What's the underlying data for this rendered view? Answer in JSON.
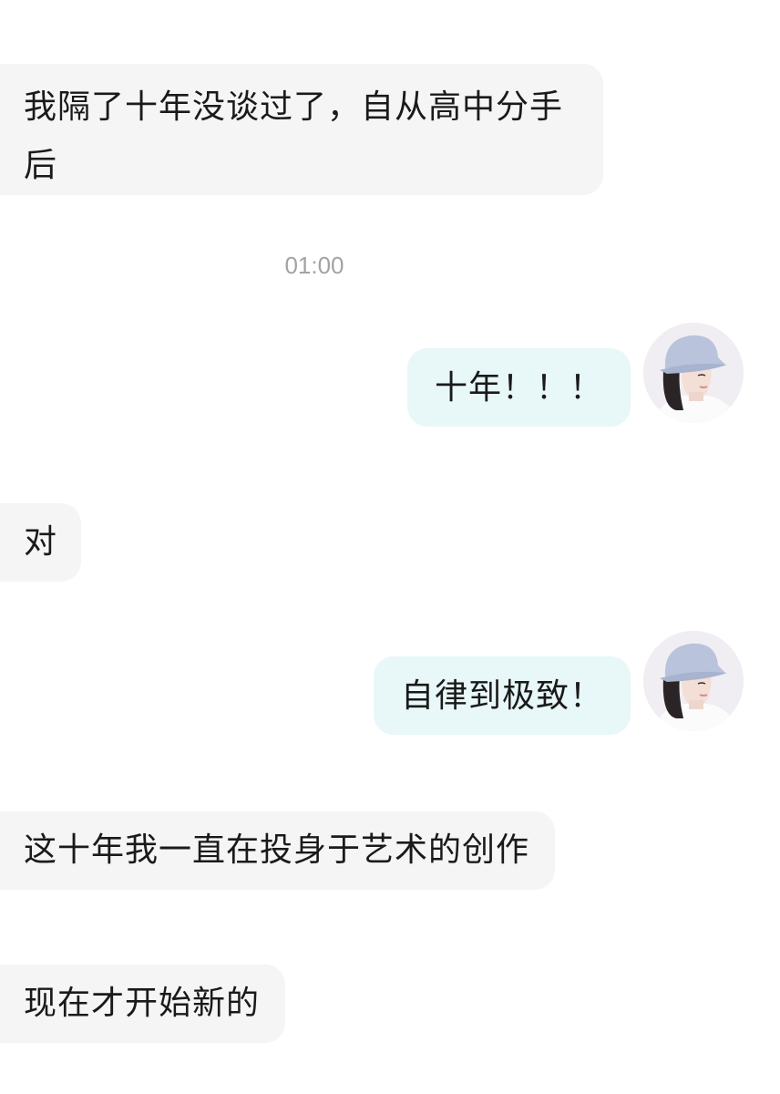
{
  "messages": [
    {
      "side": "in",
      "text": "我隔了十年没谈过了，自从高中分手后"
    },
    {
      "type": "time",
      "text": "01:00"
    },
    {
      "side": "out",
      "text": "十年！！！"
    },
    {
      "side": "in",
      "text": "对"
    },
    {
      "side": "out",
      "text": "自律到极致！"
    },
    {
      "side": "in",
      "text": "这十年我一直在投身于艺术的创作"
    },
    {
      "side": "in",
      "text": "现在才开始新的"
    }
  ],
  "avatar": {
    "icon": "avatar-girl-bucket-hat-icon",
    "hat_color": "#b9c3dc"
  }
}
